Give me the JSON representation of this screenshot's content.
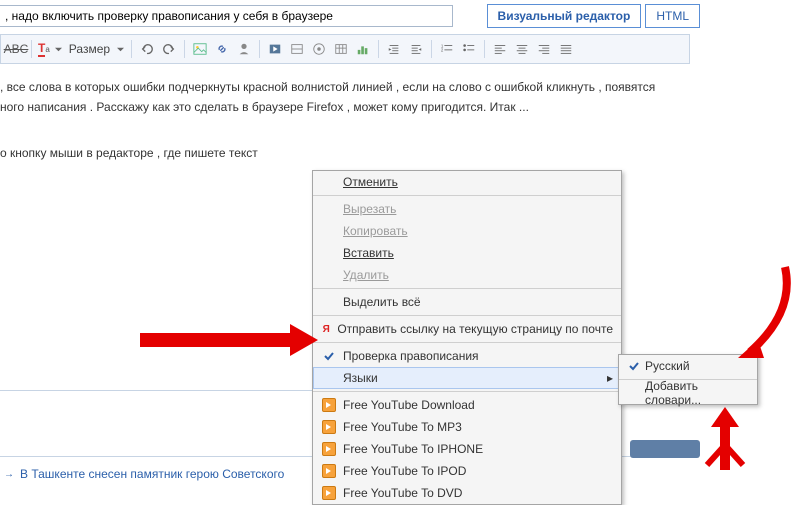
{
  "title_input": {
    "value": ", надо включить проверку правописания у себя в браузере"
  },
  "tabs": {
    "visual": "Визуальный редактор",
    "html": "HTML"
  },
  "toolbar": {
    "size_label": "Размер"
  },
  "body": {
    "line1": ", все слова в которых ошибки подчеркнуты красной волнистой линией , если на слово с ошибкой кликнуть , появятся",
    "line2": "ного написания  . Расскажу как это сделать в браузере Firefox , может кому пригодится. Итак ...",
    "line3": "о кнопку мыши в редакторе , где пишете текст"
  },
  "context_menu": {
    "undo": "Отменить",
    "cut": "Вырезать",
    "copy": "Копировать",
    "paste": "Вставить",
    "delete": "Удалить",
    "select_all": "Выделить всё",
    "send_link": "Отправить ссылку на текущую страницу по почте",
    "spellcheck": "Проверка правописания",
    "languages": "Языки",
    "yt_download": "Free YouTube Download",
    "yt_mp3": "Free YouTube To MP3",
    "yt_iphone": "Free YouTube To IPHONE",
    "yt_ipod": "Free YouTube To IPOD",
    "yt_dvd": "Free YouTube To DVD"
  },
  "submenu": {
    "russian": "Русский",
    "add_dict": "Добавить словари..."
  },
  "bottom_link": "В Ташкенте снесен памятник герою Советского"
}
